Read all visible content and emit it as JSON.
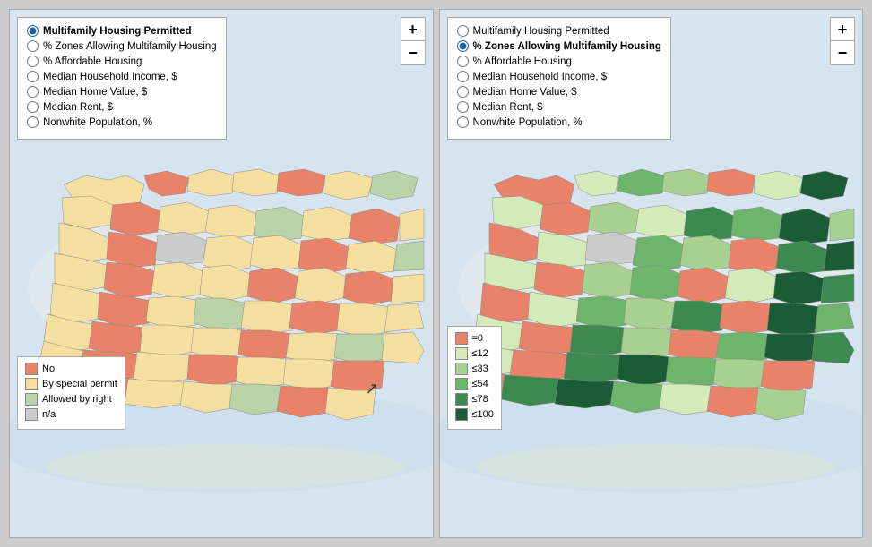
{
  "panels": [
    {
      "id": "left",
      "radio_options": [
        {
          "id": "mhp_l",
          "label": "Multifamily Housing Permitted",
          "selected": true
        },
        {
          "id": "pzmh_l",
          "label": "% Zones Allowing Multifamily Housing",
          "selected": false
        },
        {
          "id": "pah_l",
          "label": "% Affordable Housing",
          "selected": false
        },
        {
          "id": "mhi_l",
          "label": "Median Household Income, $",
          "selected": false
        },
        {
          "id": "mhv_l",
          "label": "Median Home Value, $",
          "selected": false
        },
        {
          "id": "mr_l",
          "label": "Median Rent, $",
          "selected": false
        },
        {
          "id": "np_l",
          "label": "Nonwhite Population, %",
          "selected": false
        }
      ],
      "zoom_plus": "+",
      "zoom_minus": "−",
      "legend": {
        "items": [
          {
            "color": "#e8836a",
            "label": "No"
          },
          {
            "color": "#f5dfa0",
            "label": "By special permit"
          },
          {
            "color": "#b8d4a8",
            "label": "Allowed by right"
          },
          {
            "color": "#cccccc",
            "label": "n/a"
          }
        ]
      }
    },
    {
      "id": "right",
      "radio_options": [
        {
          "id": "mhp_r",
          "label": "Multifamily Housing Permitted",
          "selected": false
        },
        {
          "id": "pzmh_r",
          "label": "% Zones Allowing Multifamily Housing",
          "selected": true
        },
        {
          "id": "pah_r",
          "label": "% Affordable Housing",
          "selected": false
        },
        {
          "id": "mhi_r",
          "label": "Median Household Income, $",
          "selected": false
        },
        {
          "id": "mhv_r",
          "label": "Median Home Value, $",
          "selected": false
        },
        {
          "id": "mr_r",
          "label": "Median Rent, $",
          "selected": false
        },
        {
          "id": "np_r",
          "label": "Nonwhite Population, %",
          "selected": false
        }
      ],
      "zoom_plus": "+",
      "zoom_minus": "−",
      "legend": {
        "items": [
          {
            "color": "#e8836a",
            "label": "=0"
          },
          {
            "color": "#d4eab8",
            "label": "≤12"
          },
          {
            "color": "#a8d090",
            "label": "≤33"
          },
          {
            "color": "#6db56d",
            "label": "≤54"
          },
          {
            "color": "#3d8a50",
            "label": "≤78"
          },
          {
            "color": "#1a5c35",
            "label": "≤100"
          }
        ]
      }
    }
  ]
}
